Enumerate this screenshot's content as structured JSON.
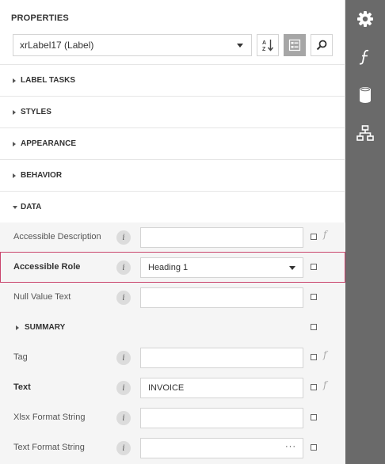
{
  "panel": {
    "title": "PROPERTIES",
    "component_select": {
      "value": "xrLabel17 (Label)"
    },
    "toolbar": {
      "sort_icon": "sort-az-icon",
      "categories_icon": "categories-icon",
      "search_icon": "search-icon"
    }
  },
  "sections": {
    "label_tasks": "LABEL TASKS",
    "styles": "STYLES",
    "appearance": "APPEARANCE",
    "behavior": "BEHAVIOR",
    "data": "DATA"
  },
  "data_rows": {
    "accessible_description": {
      "label": "Accessible Description",
      "value": ""
    },
    "accessible_role": {
      "label": "Accessible Role",
      "value": "Heading 1"
    },
    "null_value_text": {
      "label": "Null Value Text",
      "value": ""
    },
    "summary": {
      "label": "SUMMARY"
    },
    "tag": {
      "label": "Tag",
      "value": ""
    },
    "text": {
      "label": "Text",
      "value": "INVOICE"
    },
    "xlsx_format_string": {
      "label": "Xlsx Format String",
      "value": ""
    },
    "text_format_string": {
      "label": "Text Format String",
      "value": "",
      "ellipsis": "···"
    }
  },
  "info_glyph": "i",
  "expression_glyph": "f",
  "rail": {
    "items": [
      "gear-icon",
      "function-icon",
      "database-icon",
      "hierarchy-icon"
    ]
  },
  "colors": {
    "rail": "#6a6a6a",
    "selected_border": "#c9446c",
    "active_button": "#a6a6a6"
  }
}
